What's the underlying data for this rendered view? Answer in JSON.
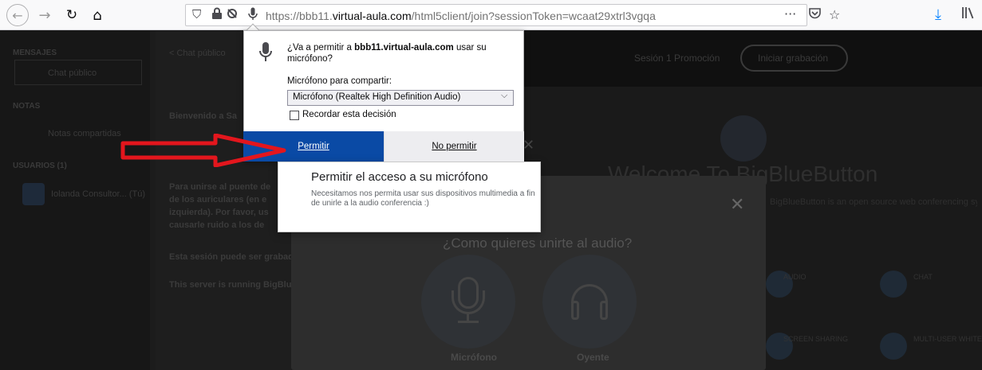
{
  "browser": {
    "url_prefix": "https://bbb11.",
    "url_host": "virtual-aula.com",
    "url_rest": "/html5client/join?sessionToken=wcaat29xtrl3vgqa",
    "more_label": "···"
  },
  "sidebar": {
    "messages_header": "MENSAJES",
    "public_chat": "Chat público",
    "notes_header": "NOTAS",
    "shared_notes": "Notas compartidas",
    "users_header": "USUARIOS (1)",
    "user_name": "Iolanda Consultor... (Tú)"
  },
  "chat": {
    "header": "< Chat público",
    "line1": "Bienvenido a Sa",
    "line2": "Para unirse al puente de",
    "line3": "de los auriculares (en e",
    "line4": "izquierda). Por favor, us",
    "line5": "causarle ruido a los de",
    "line6": "Esta sesión puede ser grabad",
    "line7": "This server is running BigBlu"
  },
  "main": {
    "recording_text": "Sesión 1 Promoción",
    "start_recording": "Iniciar grabación",
    "welcome": "Welcome To BigBlueButton",
    "welcome_sub": "BigBlueButton is an open source web conferencing system designed for online learning",
    "feature1": "AUDIO",
    "feature2": "CHAT",
    "feature3": "SCREEN SHARING",
    "feature4": "MULTI-USER WHITEBOARD"
  },
  "audio_modal": {
    "title": "¿Como quieres unirte al audio?",
    "microphone": "Micrófono",
    "listen": "Oyente"
  },
  "permission": {
    "question_pre": "¿Va a permitir a ",
    "question_host": "bbb11.virtual-aula.com",
    "question_post": " usar su micrófono?",
    "share_label": "Micrófono para compartir:",
    "device": "Micrófono (Realtek High Definition Audio)",
    "remember": "Recordar esta decisión",
    "allow": "Permitir",
    "deny": "No permitir"
  },
  "info_card": {
    "title": "Permitir el acceso a su micrófono",
    "body": "Necesitamos nos permita usar sus dispositivos multimedia a fin de unirle a la audio conferencia :)"
  },
  "colors": {
    "allow_button": "#0a4aa5",
    "arrow": "#e3161d",
    "download_icon": "#0a84ff"
  }
}
